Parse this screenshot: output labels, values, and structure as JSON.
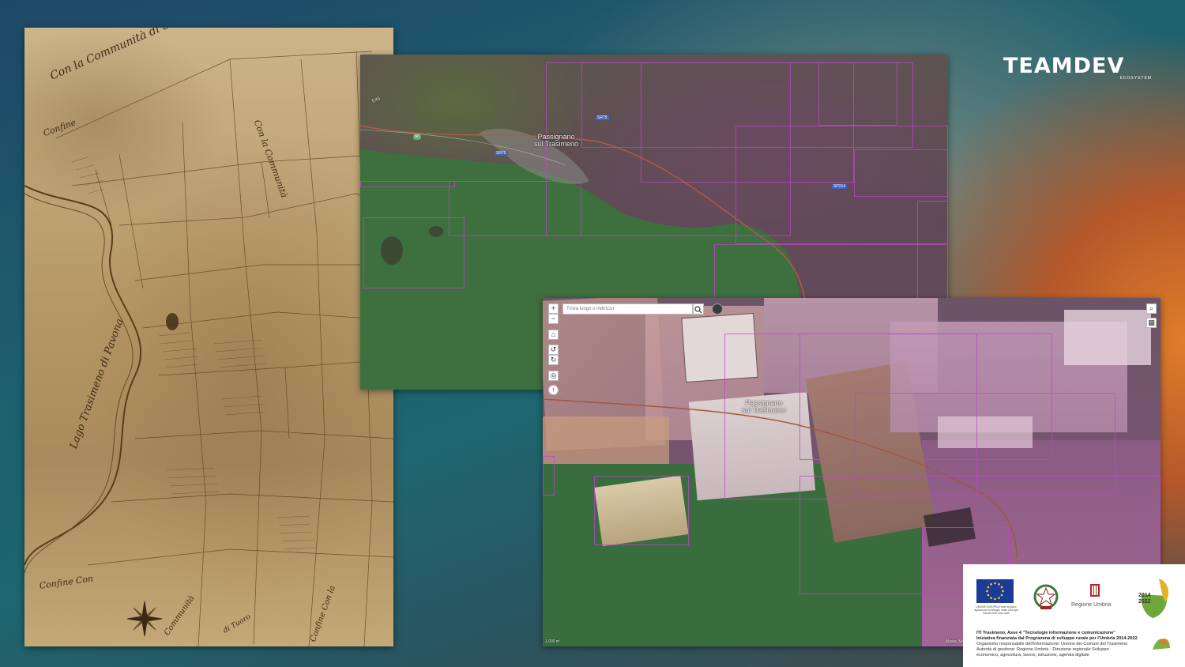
{
  "logo": {
    "name": "TEAMDEV",
    "tagline": "ECOSYSTEM"
  },
  "parchment": {
    "labels": {
      "top": "Con la Communità di S. Feliciano",
      "left_side": "Confine",
      "lake": "Lago Trasimeno di Pavona",
      "right_middle": "Con la Communità",
      "bottom_left": "Confine Con",
      "bottom_mid": "Communità",
      "bottom_right": "Confine Con la",
      "bottom_place": "di Tuoro"
    }
  },
  "satellite": {
    "town_label": "Passignano sul Trasimeno",
    "road_labels": [
      "SR75",
      "SR75",
      "SP314",
      "E45"
    ],
    "badge": "ND"
  },
  "app": {
    "search_placeholder": "Trova luogo o indirizzo",
    "zoom_in": "+",
    "zoom_out": "−",
    "town_label": "Passignano sul Trasimeno",
    "scale": "1,000 m",
    "attribution": "Maxar, Mi"
  },
  "funding": {
    "regione": "Regione Umbria",
    "eu_caption": "UNIONE EUROPEA Fondo europeo agricolo per lo sviluppo rurale L'Europa investe nelle zone rurali",
    "psr_years_1": "2014",
    "psr_years_2": "2022",
    "line1": "ITI Trasimeno, Asse 4 \"Tecnologie informazione e comunicazione\"",
    "line2": "Iniziativa finanziata dal Programma di sviluppo rurale per l'Umbria 2014-2022",
    "line3": "Organismo responsabile dell'informazione: Unione dei Comuni del Trasimeno",
    "line4": "Autorità di gestione: Regione Umbria - Direzione regionale Sviluppo",
    "line5": "economico, agricoltura, lavoro, istruzione, agenda digitale"
  },
  "colors": {
    "grid": "#be46c8",
    "lake": "#3e6f3e",
    "parchment": "#b89b6a",
    "eu_blue": "#1a3c96",
    "accent_orange": "#e07c2a"
  }
}
